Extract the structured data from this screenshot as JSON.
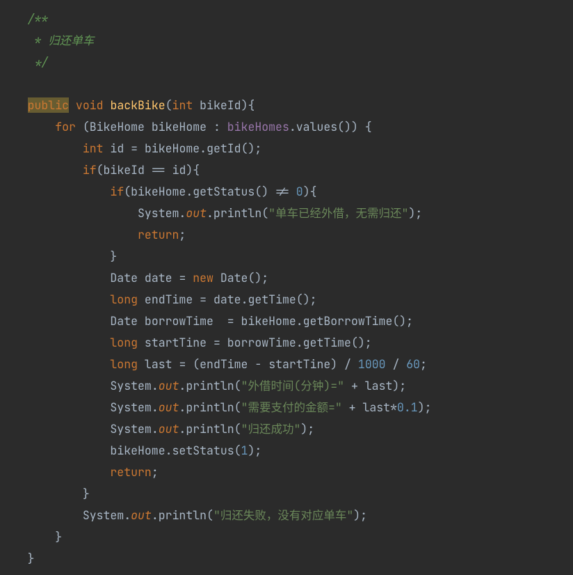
{
  "comment": {
    "open": "/**",
    "line": " * 归还单车",
    "close": " */"
  },
  "keywords": {
    "public": "public",
    "void": "void",
    "int": "int",
    "for": "for",
    "if": "if",
    "return": "return",
    "new": "new",
    "long": "long",
    "out": "out"
  },
  "identifiers": {
    "backBike": "backBike",
    "bikeId": "bikeId",
    "BikeHome": "BikeHome",
    "bikeHome": "bikeHome",
    "bikeHomes": "bikeHomes",
    "values": "values",
    "id": "id",
    "getId": "getId",
    "getStatus": "getStatus",
    "System": "System",
    "println": "println",
    "Date": "Date",
    "date": "date",
    "endTime": "endTime",
    "getTime": "getTime",
    "borrowTime": "borrowTime",
    "getBorrowTime": "getBorrowTime",
    "startTine": "startTine",
    "last": "last",
    "setStatus": "setStatus"
  },
  "strings": {
    "s1": "\"单车已经外借，无需归还\"",
    "s2": "\"外借时间(分钟)=\"",
    "s3": "\"需要支付的金额=\"",
    "s4": "\"归还成功\"",
    "s5": "\"归还失败，没有对应单车\""
  },
  "numbers": {
    "n0": "0",
    "n1": "1",
    "n1000": "1000",
    "n60": "60",
    "n01": "0.1"
  },
  "punct": {
    "op_paren": "(",
    "cl_paren": ")",
    "op_brace": "{",
    "cl_brace": "}",
    "semi": ";",
    "dot": ".",
    "colon": ":",
    "eq": "=",
    "neq": "!=",
    "eqeq": "==",
    "plus": "+",
    "minus": "-",
    "slash": "/",
    "star": "*",
    "sp": " "
  }
}
